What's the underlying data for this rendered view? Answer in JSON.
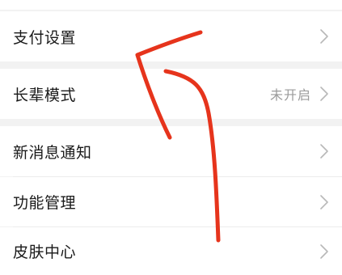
{
  "settings": {
    "items": [
      {
        "label": "支付设置",
        "value": ""
      },
      {
        "label": "长辈模式",
        "value": "未开启"
      },
      {
        "label": "新消息通知",
        "value": ""
      },
      {
        "label": "功能管理",
        "value": ""
      },
      {
        "label": "皮肤中心",
        "value": ""
      }
    ]
  },
  "colors": {
    "background": "#f2f2f2",
    "row": "#ffffff",
    "text": "#1a1a1a",
    "muted": "#9b9b9b",
    "chevron": "#b8b8b8",
    "annotation": "#e6341c"
  },
  "icons": {
    "row_arrow": "chevron-right-icon"
  }
}
